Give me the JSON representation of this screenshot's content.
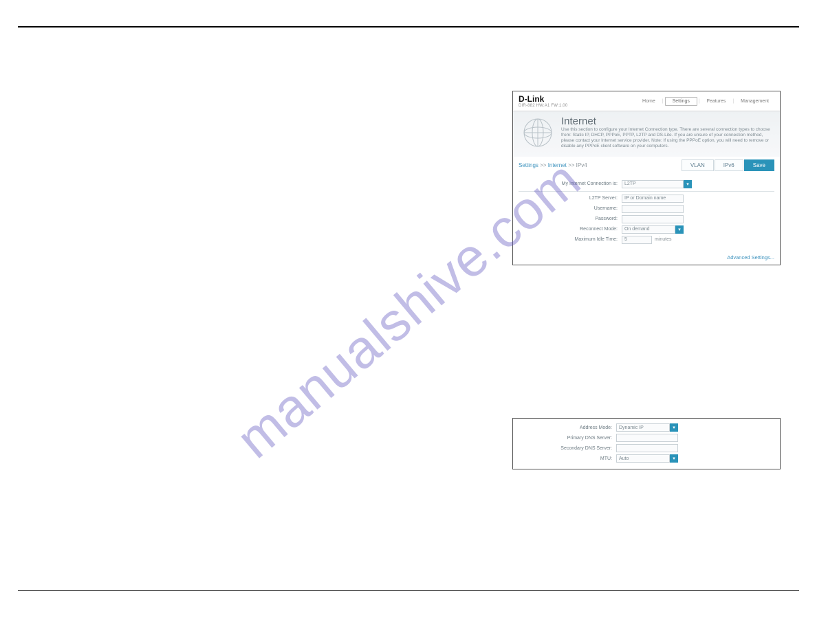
{
  "watermark": "manualshive.com",
  "router": {
    "brand": "D-Link",
    "fw": "DIR-882 HW:A1 FW:1.00",
    "nav": {
      "home": "Home",
      "settings": "Settings",
      "features": "Features",
      "management": "Management"
    },
    "hero": {
      "title": "Internet",
      "desc": "Use this section to configure your Internet Connection type. There are several connection types to choose from: Static IP, DHCP, PPPoE, PPTP, L2TP and DS-Lite. If you are unsure of your connection method, please contact your Internet service provider. Note: If using the PPPoE option, you will need to remove or disable any PPPoE client software on your computers."
    },
    "crumbs": {
      "a": "Settings",
      "b": "Internet",
      "c": "IPv4"
    },
    "buttons": {
      "vlan": "VLAN",
      "ipv6": "IPv6",
      "save": "Save"
    },
    "fields": {
      "connection_label": "My Internet Connection is:",
      "connection_value": "L2TP",
      "l2tp_server_label": "L2TP Server:",
      "l2tp_server_placeholder": "IP or Domain name",
      "username_label": "Username:",
      "password_label": "Password:",
      "reconnect_label": "Reconnect Mode:",
      "reconnect_value": "On demand",
      "idle_label": "Maximum Idle Time:",
      "idle_value": "5",
      "idle_suffix": "minutes"
    },
    "adv_link": "Advanced Settings...",
    "advanced": {
      "address_mode_label": "Address Mode:",
      "address_mode_value": "Dynamic IP",
      "primary_dns_label": "Primary DNS Server:",
      "secondary_dns_label": "Secondary DNS Server:",
      "mtu_label": "MTU:",
      "mtu_value": "Auto"
    }
  }
}
